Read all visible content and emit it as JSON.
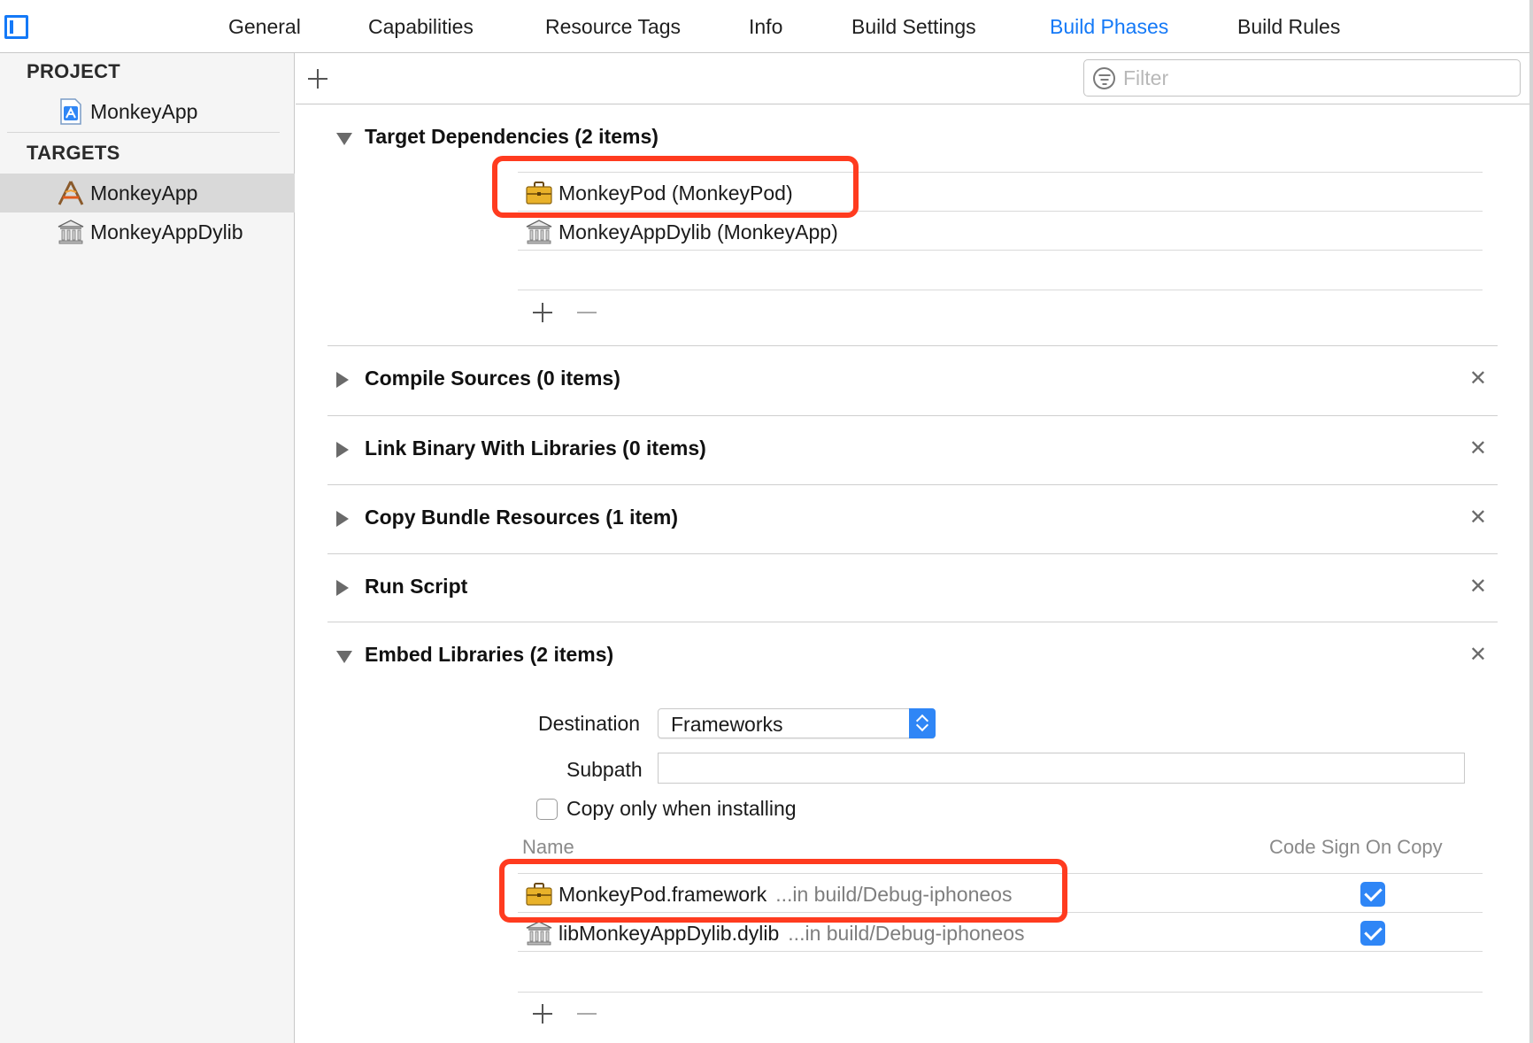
{
  "tabs": [
    {
      "label": "General"
    },
    {
      "label": "Capabilities"
    },
    {
      "label": "Resource Tags"
    },
    {
      "label": "Info"
    },
    {
      "label": "Build Settings"
    },
    {
      "label": "Build Phases",
      "active": true
    },
    {
      "label": "Build Rules"
    }
  ],
  "sidebar": {
    "project_header": "PROJECT",
    "project_item": "MonkeyApp",
    "targets_header": "TARGETS",
    "targets": [
      {
        "label": "MonkeyApp",
        "selected": true
      },
      {
        "label": "MonkeyAppDylib"
      }
    ]
  },
  "filter": {
    "placeholder": "Filter"
  },
  "phases": {
    "target_dependencies": {
      "title": "Target Dependencies (2 items)",
      "items": [
        {
          "label": "MonkeyPod (MonkeyPod)",
          "icon": "briefcase-icon"
        },
        {
          "label": "MonkeyAppDylib (MonkeyApp)",
          "icon": "library-icon"
        }
      ]
    },
    "compile_sources": {
      "title": "Compile Sources (0 items)"
    },
    "link_binary": {
      "title": "Link Binary With Libraries (0 items)"
    },
    "copy_bundle": {
      "title": "Copy Bundle Resources (1 item)"
    },
    "run_script": {
      "title": "Run Script"
    },
    "embed_libraries": {
      "title": "Embed Libraries (2 items)",
      "destination_label": "Destination",
      "destination_value": "Frameworks",
      "subpath_label": "Subpath",
      "subpath_value": "",
      "copy_only_label": "Copy only when installing",
      "copy_only_checked": false,
      "col_name": "Name",
      "col_codesign": "Code Sign On Copy",
      "items": [
        {
          "name": "MonkeyPod.framework",
          "location": "...in build/Debug-iphoneos",
          "code_sign": true,
          "icon": "briefcase-icon"
        },
        {
          "name": "libMonkeyAppDylib.dylib",
          "location": "...in build/Debug-iphoneos",
          "code_sign": true,
          "icon": "library-icon"
        }
      ]
    }
  },
  "colors": {
    "accent": "#1479f7",
    "highlight_box": "#ff3b1f",
    "checkbox": "#2f86f6"
  }
}
